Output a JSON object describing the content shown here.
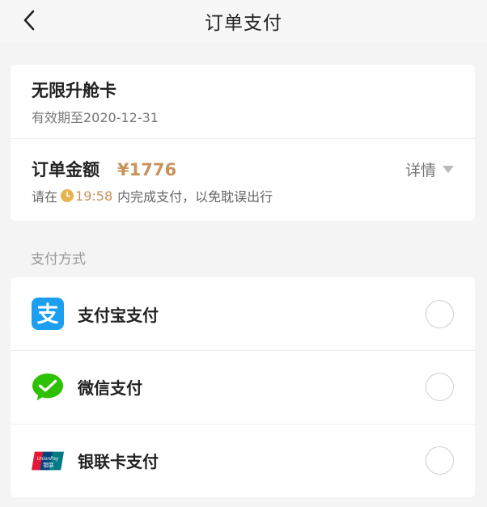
{
  "navbar": {
    "title": "订单支付",
    "back_icon": "chevron-left-icon"
  },
  "order": {
    "product_name": "无限升舱卡",
    "validity": "有效期至2020-12-31",
    "amount_label": "订单金额",
    "amount_value": "¥1776",
    "details_label": "详情",
    "notice_prefix": "请在",
    "countdown": "19:58",
    "notice_suffix": "内完成支付，以免耽误出行"
  },
  "payment": {
    "section_title": "支付方式",
    "methods": [
      {
        "label": "支付宝支付",
        "icon": "alipay-icon",
        "selected": false
      },
      {
        "label": "微信支付",
        "icon": "wechat-pay-icon",
        "selected": false
      },
      {
        "label": "银联卡支付",
        "icon": "unionpay-icon",
        "selected": false
      }
    ]
  },
  "colors": {
    "accent_gold": "#c8935b",
    "alipay_blue": "#1c9ff0",
    "wechat_green": "#2dc100",
    "background": "#f4f4f4"
  }
}
